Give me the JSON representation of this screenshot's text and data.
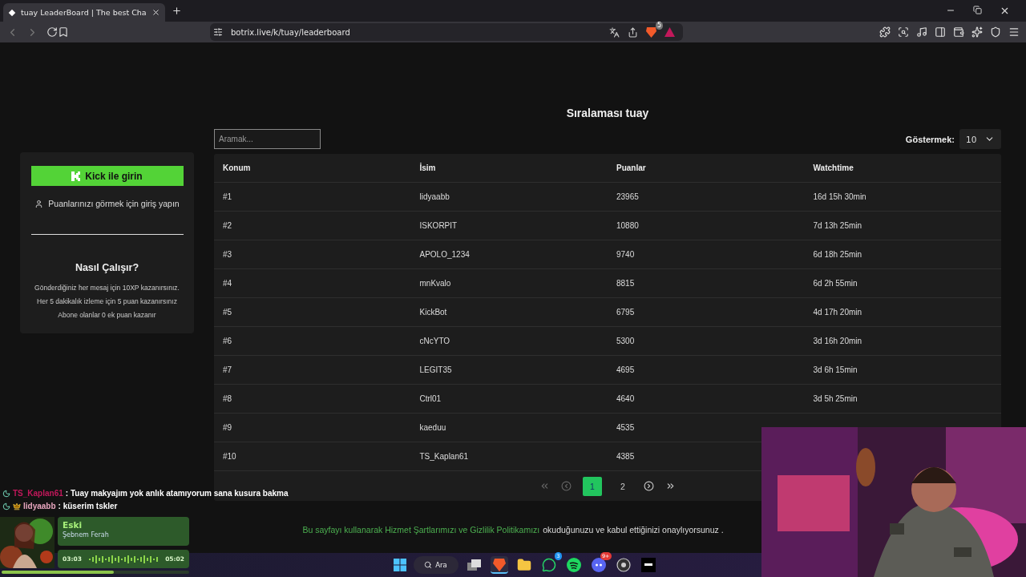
{
  "browser": {
    "tab_title": "tuay LeaderBoard | The best Cha",
    "url": "botrix.live/k/tuay/leaderboard",
    "shields_badge": "5"
  },
  "sidebar": {
    "login_button": "Kick ile girin",
    "login_hint": "Puanlarınızı görmek için giriş yapın",
    "how_title": "Nasıl Çalışır?",
    "how_lines": [
      "Gönderdiğiniz her mesaj için 10XP kazanırsınız.",
      "Her 5 dakikalık izleme için 5 puan kazanırsınız",
      "Abone olanlar 0 ek puan kazanır"
    ]
  },
  "leaderboard": {
    "title": "Sıralaması tuay",
    "search_placeholder": "Aramak...",
    "show_label": "Göstermek:",
    "show_value": "10",
    "columns": [
      "Konum",
      "İsim",
      "Puanlar",
      "Watchtime"
    ],
    "rows": [
      {
        "rank": "#1",
        "name": "lidyaabb",
        "points": "23965",
        "watchtime": "16d 15h 30min"
      },
      {
        "rank": "#2",
        "name": "ISKORPIT",
        "points": "10880",
        "watchtime": "7d 13h 25min"
      },
      {
        "rank": "#3",
        "name": "APOLO_1234",
        "points": "9740",
        "watchtime": "6d 18h 25min"
      },
      {
        "rank": "#4",
        "name": "mnKvalo",
        "points": "8815",
        "watchtime": "6d 2h 55min"
      },
      {
        "rank": "#5",
        "name": "KickBot",
        "points": "6795",
        "watchtime": "4d 17h 20min"
      },
      {
        "rank": "#6",
        "name": "cNcYTO",
        "points": "5300",
        "watchtime": "3d 16h 20min"
      },
      {
        "rank": "#7",
        "name": "LEGIT35",
        "points": "4695",
        "watchtime": "3d 6h 15min"
      },
      {
        "rank": "#8",
        "name": "Ctrl01",
        "points": "4640",
        "watchtime": "3d 5h 25min"
      },
      {
        "rank": "#9",
        "name": "kaeduu",
        "points": "4535"
      },
      {
        "rank": "#10",
        "name": "TS_Kaplan61",
        "points": "4385"
      }
    ],
    "pages": [
      {
        "label": "1",
        "selected": true
      },
      {
        "label": "2",
        "selected": false
      }
    ]
  },
  "footer": {
    "link": "Bu sayfayı kullanarak Hizmet Şartlarımızı ve Gizlilik Politikamızı",
    "text": "okuduğunuzu ve kabul ettiğinizi onaylıyorsunuz ."
  },
  "chat": [
    {
      "user": "TS_Kaplan61",
      "color": "#c2185b",
      "badge": false,
      "message": ": Tuay makyajım yok anlık atamıyorum sana kusura bakma"
    },
    {
      "user": "lidyaabb",
      "color": "#e8a6bf",
      "badge": true,
      "message": ": küserim tskler"
    }
  ],
  "now_playing": {
    "title": "Eski",
    "artist": "Şebnem Ferah",
    "elapsed": "03:03",
    "total": "05:02",
    "level": 0.6
  },
  "taskbar": {
    "search": "Ara",
    "apps": [
      {
        "kind": "taskview",
        "active": false
      },
      {
        "kind": "browser",
        "active": true
      },
      {
        "kind": "folder",
        "active": false
      },
      {
        "kind": "whatsapp",
        "active": false,
        "badge": "3"
      },
      {
        "kind": "spotify",
        "active": false
      },
      {
        "kind": "discord",
        "active": false,
        "badge": "9+"
      },
      {
        "kind": "obs",
        "active": false
      },
      {
        "kind": "app",
        "active": false
      }
    ]
  }
}
